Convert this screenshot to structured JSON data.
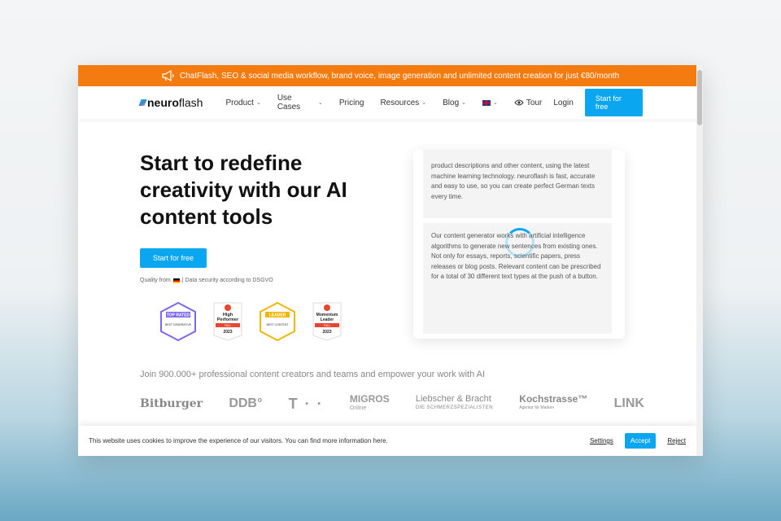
{
  "banner": {
    "text": "ChatFlash, SEO & social media workflow, brand voice, image generation and unlimited content creation for just €80/month"
  },
  "nav": {
    "logo_bold": "neuro",
    "logo_rest": "flash",
    "items": [
      {
        "label": "Product",
        "dropdown": true
      },
      {
        "label": "Use Cases",
        "dropdown": true
      },
      {
        "label": "Pricing",
        "dropdown": false
      },
      {
        "label": "Resources",
        "dropdown": true
      },
      {
        "label": "Blog",
        "dropdown": true
      }
    ],
    "language_icon": "uk-flag-icon",
    "tour": "Tour",
    "login": "Login",
    "cta": "Start for free"
  },
  "hero": {
    "headline": "Start to redefine creativity with our AI content tools",
    "cta": "Start for free",
    "quality_prefix": "Quality from",
    "quality_suffix": "| Data security according to DSGVO"
  },
  "badges": [
    {
      "name": "TOP RATED",
      "sub": "BEST GENERATIVE",
      "color": "#7b68ee"
    },
    {
      "name": "High Performer",
      "sub": "FALL",
      "year": "2023",
      "color": "#e8462e"
    },
    {
      "name": "LEADER",
      "sub": "BEST CONTENT",
      "color": "#f2b705"
    },
    {
      "name": "Momentum Leader",
      "sub": "FALL",
      "year": "2023",
      "color": "#e8462e"
    }
  ],
  "editor": {
    "para1": "product descriptions and other content, using the latest machine learning technology. neuroflash is fast, accurate and easy to use, so you can create perfect German texts every time.",
    "para2": "Our content generator works with artificial intelligence algorithms to generate new sentences from existing ones. Not only for essays, reports, scientific papers, press releases or blog posts. Relevant content can be prescribed for a total of 30 different text types at the push of a button."
  },
  "social_proof": {
    "text": "Join 900.000+ professional content creators and teams and empower your work with AI",
    "logos": [
      {
        "name": "Bitburger"
      },
      {
        "name": "DDB°"
      },
      {
        "name": "T · ·"
      },
      {
        "name": "MIGROS",
        "sub": "Online"
      },
      {
        "name": "Liebscher & Bracht",
        "sub": "DIE SCHMERZSPEZIALISTEN"
      },
      {
        "name": "Kochstrasse™",
        "sub": "Agentur für Marken"
      },
      {
        "name": "LINK"
      }
    ]
  },
  "cookie": {
    "text": "This website uses cookies to improve the experience of our visitors. You can find more information here.",
    "settings": "Settings",
    "accept": "Accept",
    "reject": "Reject"
  },
  "colors": {
    "banner": "#f47b0f",
    "primary": "#0aa6f0"
  }
}
